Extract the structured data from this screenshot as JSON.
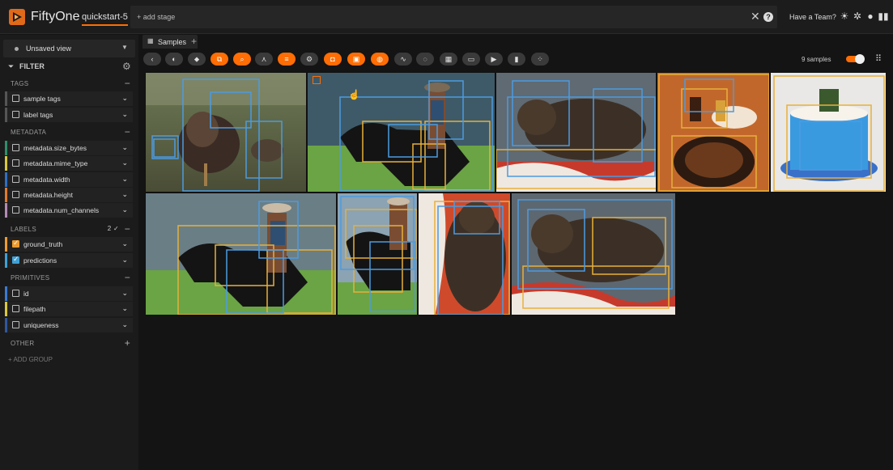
{
  "app": {
    "brand": "FiftyOne",
    "dataset": "quickstart-5"
  },
  "topbar": {
    "add_stage": "+ add stage",
    "clear_icon": "close-icon",
    "help_icon": "help-icon",
    "team": "Have a Team?",
    "icons": [
      "sun-icon",
      "slack-icon",
      "github-icon",
      "docs-icon"
    ]
  },
  "sidebar": {
    "view": "Unsaved view",
    "filter": "FILTER",
    "groups": {
      "tags": {
        "title": "TAGS",
        "items": [
          {
            "label": "sample tags"
          },
          {
            "label": "label tags"
          }
        ]
      },
      "metadata": {
        "title": "METADATA",
        "items": [
          {
            "label": "metadata.size_bytes",
            "color": "#2f8f68"
          },
          {
            "label": "metadata.mime_type",
            "color": "#d9c83b"
          },
          {
            "label": "metadata.width",
            "color": "#2f6fc4"
          },
          {
            "label": "metadata.height",
            "color": "#e07b2b"
          },
          {
            "label": "metadata.num_channels",
            "color": "#b48ab4"
          }
        ]
      },
      "labels": {
        "title": "LABELS",
        "count": "2",
        "items": [
          {
            "label": "ground_truth",
            "color": "#ee9b2e",
            "checked": true
          },
          {
            "label": "predictions",
            "color": "#3fa0d6",
            "checked": true
          }
        ]
      },
      "primitives": {
        "title": "PRIMITIVES",
        "items": [
          {
            "label": "id",
            "color": "#3a7bd5"
          },
          {
            "label": "filepath",
            "color": "#d9c83b"
          },
          {
            "label": "uniqueness",
            "color": "#2f56a0"
          }
        ]
      },
      "other": {
        "title": "OTHER"
      }
    },
    "add_group": "+ ADD GROUP"
  },
  "tabs": {
    "samples": "Samples",
    "add": "+"
  },
  "actions": {
    "count": "9 samples"
  },
  "colors": {
    "accent": "#ff6d04",
    "gt": "#e8b03a",
    "pred": "#4c9be0"
  }
}
